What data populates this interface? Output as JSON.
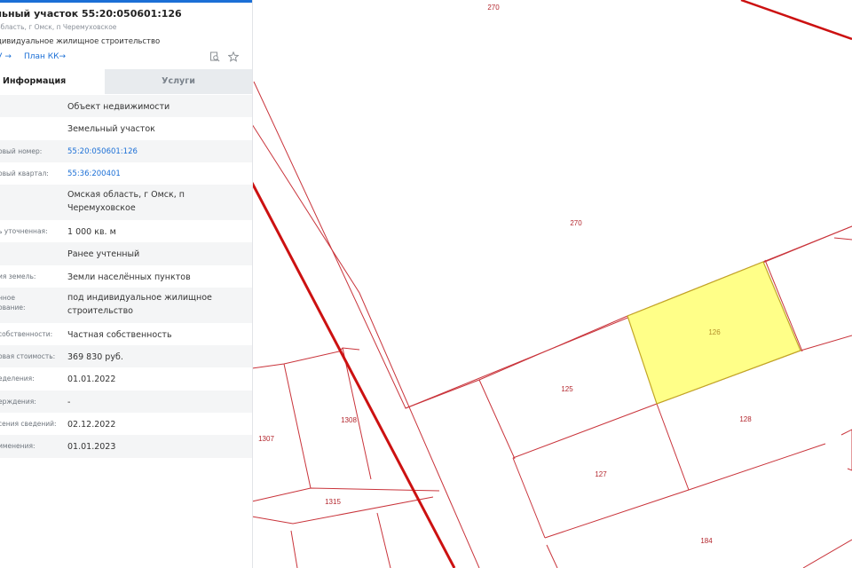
{
  "colors": {
    "accent": "#1b6fd6",
    "parcel_border": "#c9343b",
    "highlight_fill": "#ffff88",
    "highlight_border": "#c2a626",
    "rail": "#cc1111"
  },
  "panel": {
    "title": "льный участок 55:20:050601:126",
    "address": "область, г Омск, п Черемуховское",
    "use": "дивидуальное жилищное строительство",
    "link_partial": "У →",
    "link_plan": "План КК→",
    "icons": [
      "search-document-icon",
      "star-icon"
    ],
    "tabs": [
      {
        "label": "Информация",
        "active": true
      },
      {
        "label": "Услуги",
        "active": false
      }
    ],
    "rows": [
      {
        "label": "",
        "value": "Объект недвижимости",
        "link": false
      },
      {
        "label": "",
        "value": "Земельный участок",
        "link": false
      },
      {
        "label": "овый номер:",
        "value": "55:20:050601:126",
        "link": true
      },
      {
        "label": "овый квартал:",
        "value": "55:36:200401",
        "link": true
      },
      {
        "label": "",
        "value": "Омская область, г Омск, п Черемуховское",
        "link": false
      },
      {
        "label": "ь уточненная:",
        "value": "1 000 кв. м",
        "link": false
      },
      {
        "label": "",
        "value": "Ранее учтенный",
        "link": false
      },
      {
        "label": "ия земель:",
        "value": "Земли населённых пунктов",
        "link": false
      },
      {
        "label": "нное\nование:",
        "value": "под индивидуальное жилищное строительство",
        "link": false
      },
      {
        "label": "собственности:",
        "value": "Частная собственность",
        "link": false
      },
      {
        "label": "овая стоимость:",
        "value": "369 830 руб.",
        "link": false
      },
      {
        "label": "еделения:",
        "value": "01.01.2022",
        "link": false
      },
      {
        "label": "ерждения:",
        "value": "-",
        "link": false
      },
      {
        "label": "сения сведений:",
        "value": "02.12.2022",
        "link": false
      },
      {
        "label": "именения:",
        "value": "01.01.2023",
        "link": false
      }
    ]
  },
  "map": {
    "labels": [
      "270",
      "270",
      "126",
      "125",
      "128",
      "127",
      "1308",
      "1307",
      "1315",
      "184"
    ]
  }
}
